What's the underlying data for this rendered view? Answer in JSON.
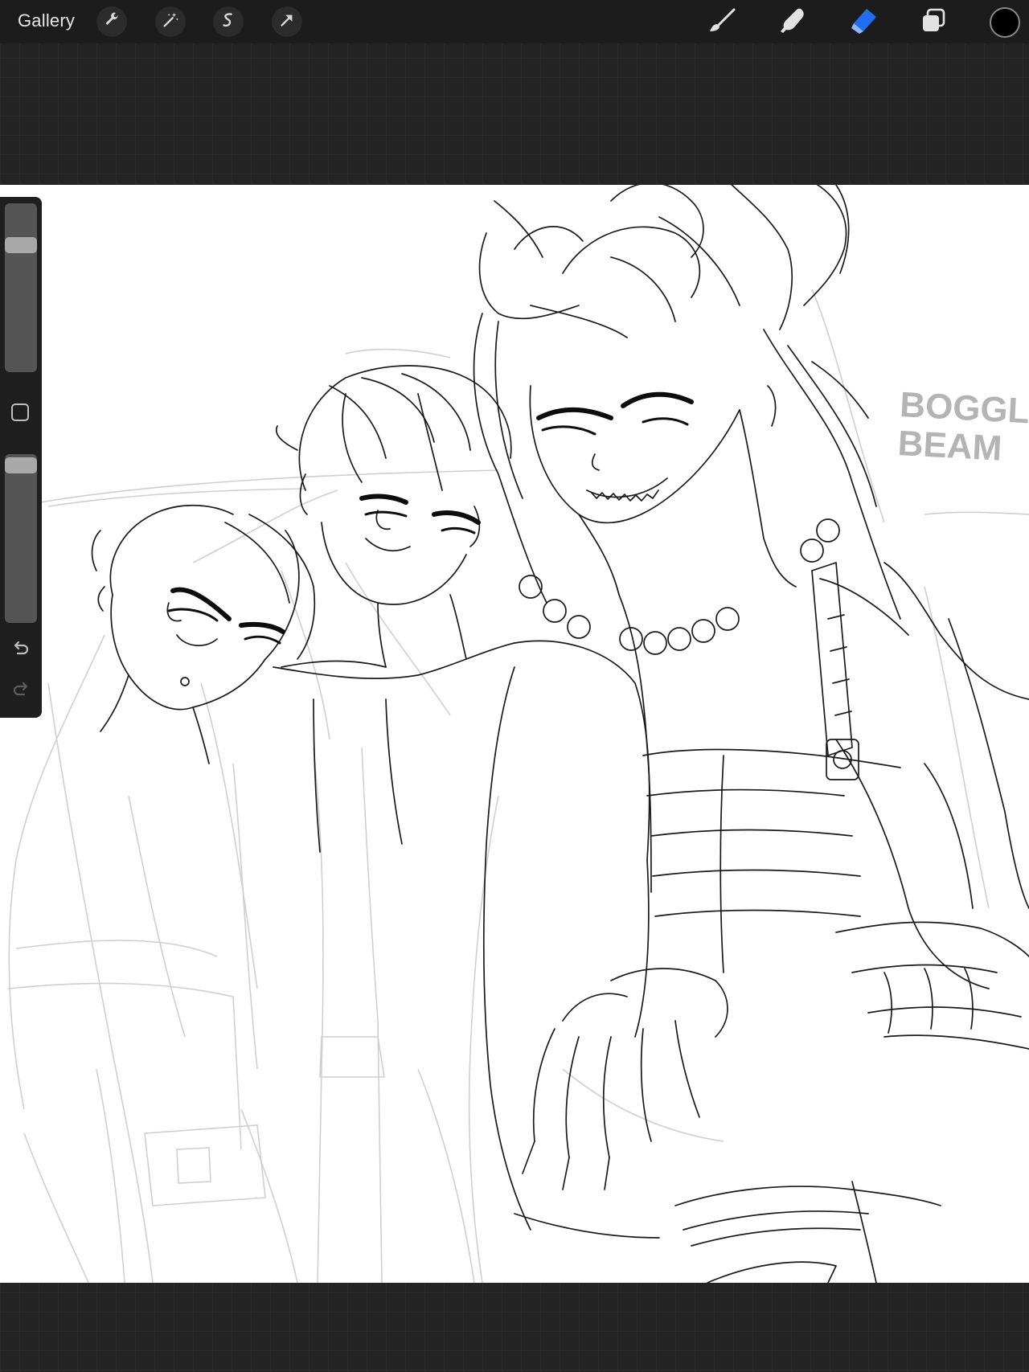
{
  "app": {
    "gallery_label": "Gallery"
  },
  "toolbar_left": [
    "wrench-icon",
    "magic-wand-icon",
    "selection-icon",
    "transform-arrow-icon"
  ],
  "toolbar_right": [
    "brush-icon",
    "smudge-icon",
    "eraser-icon",
    "layers-icon",
    "color-swatch"
  ],
  "active_tool": "eraser",
  "current_color": "#000000",
  "accent_color": "#1f6ff0",
  "sidebar": {
    "brush_size_level": 0.78,
    "opacity_level": 0.98
  },
  "canvas": {
    "watermark_line1": "BOGGLE",
    "watermark_line2": "BEAM"
  }
}
